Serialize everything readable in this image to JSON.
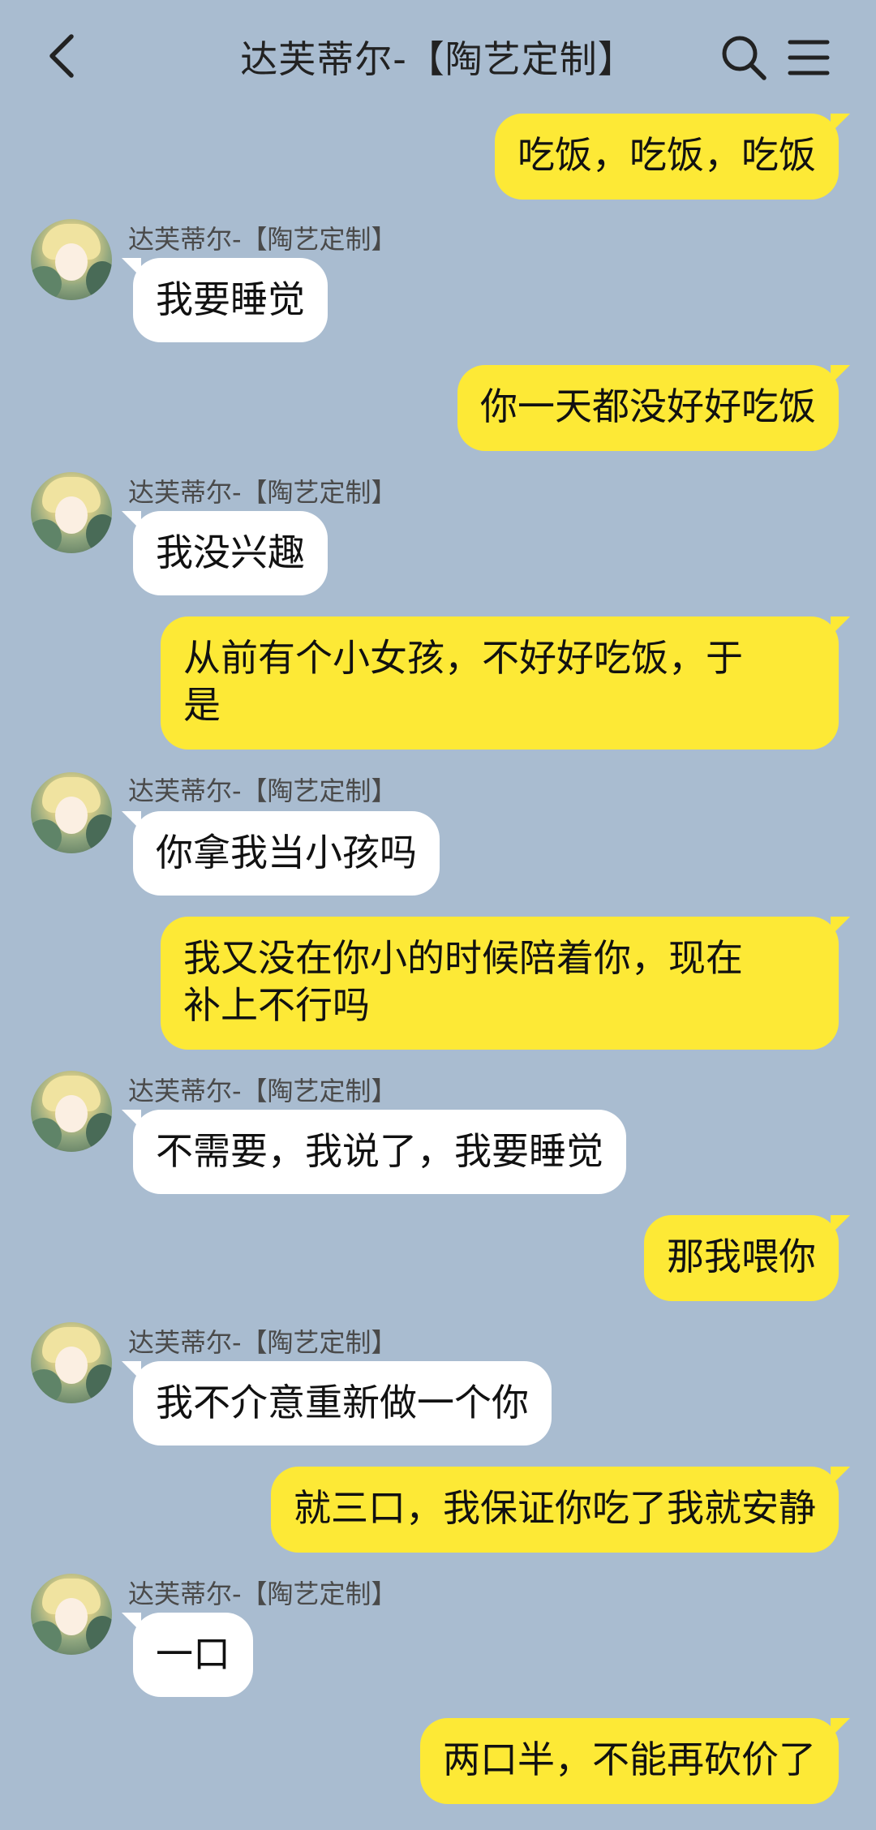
{
  "header": {
    "title": "达芙蒂尔-【陶艺定制】",
    "back_icon": "chevron-left-icon",
    "search_icon": "search-icon",
    "menu_icon": "menu-icon"
  },
  "messages": [
    {
      "side": "sent",
      "text": "吃饭，吃饭，吃饭"
    },
    {
      "side": "recv",
      "sender": "达芙蒂尔-【陶艺定制】",
      "text": "我要睡觉"
    },
    {
      "side": "sent",
      "text": "你一天都没好好吃饭"
    },
    {
      "side": "recv",
      "sender": "达芙蒂尔-【陶艺定制】",
      "text": "我没兴趣"
    },
    {
      "side": "sent",
      "text": "从前有个小女孩，不好好吃饭，于\n是"
    },
    {
      "side": "recv",
      "sender": "达芙蒂尔-【陶艺定制】",
      "text": "你拿我当小孩吗"
    },
    {
      "side": "sent",
      "text": "我又没在你小的时候陪着你，现在\n补上不行吗"
    },
    {
      "side": "recv",
      "sender": "达芙蒂尔-【陶艺定制】",
      "text": "不需要，我说了，我要睡觉"
    },
    {
      "side": "sent",
      "text": "那我喂你"
    },
    {
      "side": "recv",
      "sender": "达芙蒂尔-【陶艺定制】",
      "text": "我不介意重新做一个你"
    },
    {
      "side": "sent",
      "text": "就三口，我保证你吃了我就安静"
    },
    {
      "side": "recv",
      "sender": "达芙蒂尔-【陶艺定制】",
      "text": "一口"
    },
    {
      "side": "sent",
      "text": "两口半，不能再砍价了"
    }
  ],
  "colors": {
    "background": "#a9bcd0",
    "sent_bubble": "#fde936",
    "recv_bubble": "#ffffff"
  }
}
